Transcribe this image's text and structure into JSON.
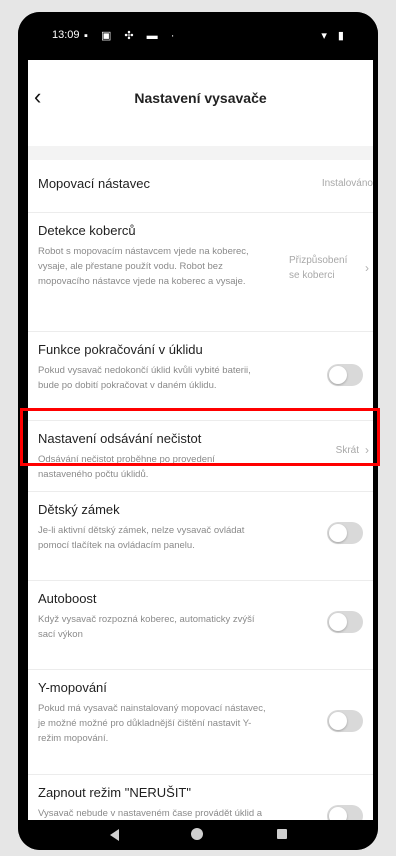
{
  "status_bar": {
    "time": "13:09",
    "left_icons": "▪ ▣ ✣ ▬ ·",
    "right_icons": "▾ ▮"
  },
  "header": {
    "title": "Nastavení vysavače",
    "back_icon": "back-arrow-icon"
  },
  "settings": [
    {
      "name": "Mopovací nástavec",
      "value": "Instalováno"
    },
    {
      "name": "Detekce koberců",
      "description": "Robot s mopovacím nástavcem vjede na koberec, vysaje, ale přestane použít vodu. Robot bez mopovacího nástavce vjede na koberec a vysaje.",
      "value": "Přizpůsobení se koberci"
    },
    {
      "name": "Funkce pokračování v úklidu",
      "description": "Pokud vysavač nedokončí úklid kvůli vybité baterii, bude po dobití pokračovat v daném úklidu.",
      "toggle": false
    },
    {
      "name": "Nastavení odsávání nečistot",
      "description": "Odsávání nečistot proběhne po provedení nastaveného počtu úklidů.",
      "value": "Skrát"
    },
    {
      "name": "Dětský zámek",
      "description": "Je-li aktivní dětský zámek, nelze vysavač ovládat pomocí tlačítek na ovládacím panelu.",
      "toggle": false
    },
    {
      "name": "Autoboost",
      "description": "Když vysavač rozpozná koberec, automaticky zvýší sací výkon",
      "toggle": false
    },
    {
      "name": "Y-mopování",
      "description": "Pokud má vysavač nainstalovaný mopovací nástavec, je možné možné pro důkladnější čištění nastavit Y-režim mopování.",
      "toggle": false
    },
    {
      "name": "Zapnout režim \"NERUŠIT\"",
      "description": "Vysavač nebude v nastaveném čase provádět úklid a hlasitost upozornění bude snížena.",
      "toggle": false
    }
  ],
  "highlight_color": "#ff0000"
}
